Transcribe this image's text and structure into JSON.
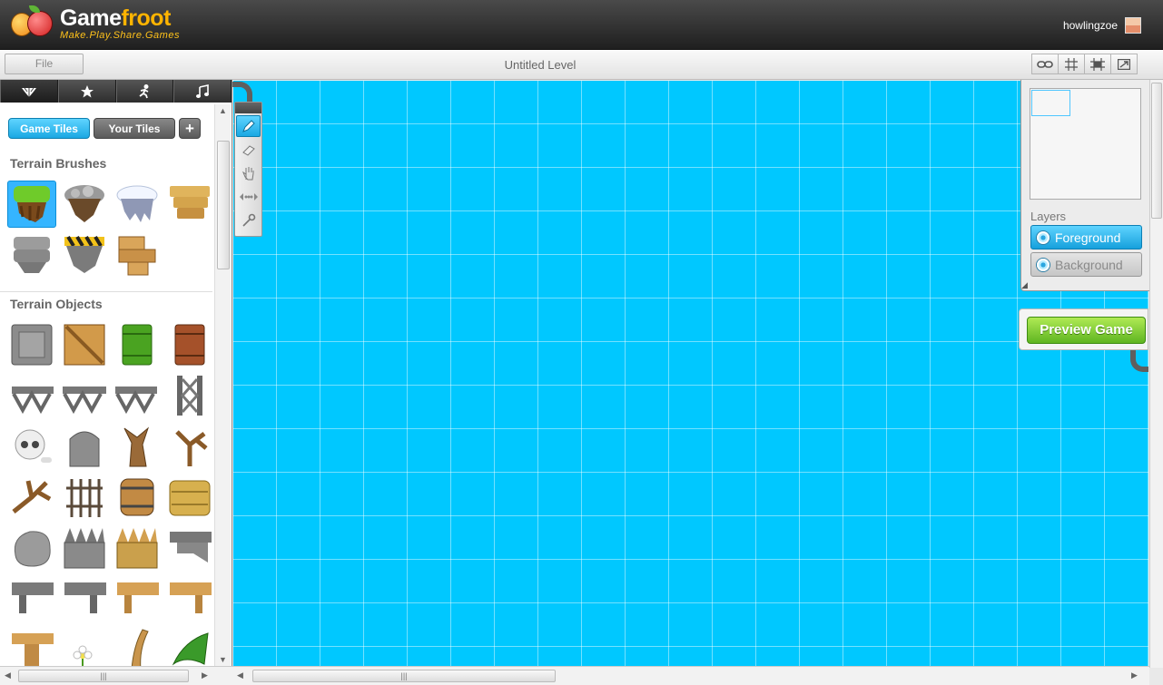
{
  "header": {
    "logo_title_a": "Game",
    "logo_title_b": "froot",
    "logo_tagline": "Make.Play.Share.Games",
    "username": "howlingzoe"
  },
  "toolbar": {
    "file_label": "File",
    "level_title": "Untitled Level",
    "right_tools": [
      "link-icon",
      "grid-icon",
      "snap-grid-icon",
      "fullscreen-icon"
    ]
  },
  "left_panel": {
    "tabs": [
      "tiles-tab-icon",
      "star-tab-icon",
      "character-tab-icon",
      "music-tab-icon"
    ],
    "game_tiles_label": "Game Tiles",
    "your_tiles_label": "Your Tiles",
    "add_label": "+",
    "terrain_brushes_title": "Terrain Brushes",
    "terrain_objects_title": "Terrain Objects",
    "brushes": [
      "grass-brush",
      "stone-brush",
      "snow-brush",
      "sandstone-brush",
      "rock-brush",
      "hazard-brush",
      "wood-brush"
    ],
    "objects": [
      "metal-crate",
      "wooden-crate",
      "oil-barrel",
      "gas-barrel",
      "girder-left",
      "girder-mid",
      "girder-right",
      "girder-vertical",
      "skull",
      "tombstone",
      "tree-trunk",
      "dead-branch",
      "branch",
      "iron-fence",
      "wooden-barrel",
      "hay-bale",
      "boulder",
      "stone-spikes",
      "wood-spikes",
      "stone-ledge",
      "metal-platform-a",
      "metal-platform-b",
      "wood-platform-a",
      "wood-platform-b",
      "wood-post",
      "flower",
      "palm-trunk",
      "palm-leaves"
    ]
  },
  "tools": [
    "pencil-icon",
    "eraser-icon",
    "hand-icon",
    "move-icon",
    "wrench-icon"
  ],
  "side_panel": {
    "layers_label": "Layers",
    "foreground_label": "Foreground",
    "background_label": "Background"
  },
  "preview_label": "Preview Game",
  "colors": {
    "canvas": "#00c8ff",
    "accent": "#1aa8e3",
    "preview": "#5fb521"
  }
}
